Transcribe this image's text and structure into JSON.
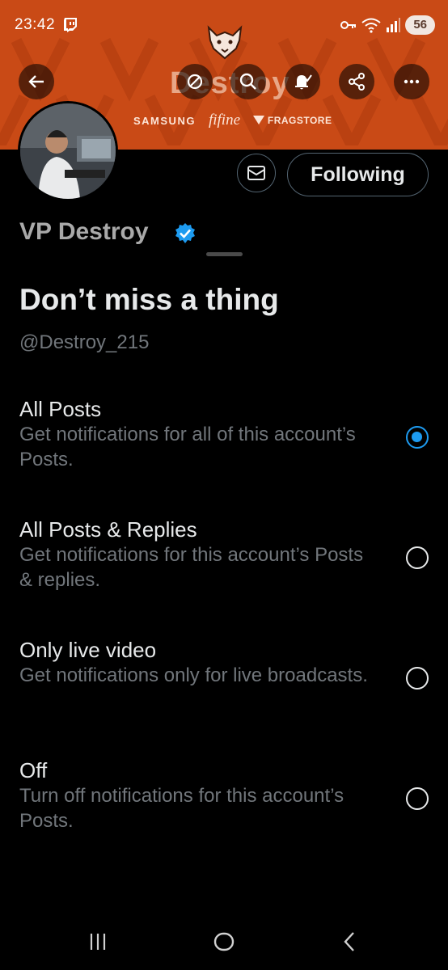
{
  "status_bar": {
    "time": "23:42",
    "battery": "56",
    "icons": [
      "twitch-icon",
      "key-icon",
      "wifi-icon",
      "signal-icon",
      "battery-icon"
    ]
  },
  "header": {
    "banner_name": "Destroy",
    "sponsors": [
      "SAMSUNG",
      "fifine",
      "FRAGSTORE"
    ],
    "icons": [
      "back-arrow-icon",
      "mute-icon",
      "search-icon",
      "bell-icon",
      "share-icon",
      "more-icon"
    ]
  },
  "profile": {
    "name": "VP Destroy",
    "following_label": "Following"
  },
  "sheet": {
    "title": "Don’t miss a thing",
    "handle": "@Destroy_215",
    "options": [
      {
        "title": "All Posts",
        "desc": "Get notifications for all of this account’s Posts.",
        "selected": true
      },
      {
        "title": "All Posts & Replies",
        "desc": "Get notifications for this account’s Posts & replies.",
        "selected": false
      },
      {
        "title": "Only live video",
        "desc": "Get notifications only for live broadcasts.",
        "selected": false
      },
      {
        "title": "Off",
        "desc": "Turn off notifications for this account’s Posts.",
        "selected": false
      }
    ]
  },
  "colors": {
    "banner": "#c94a16",
    "accent": "#1d9bf0",
    "background": "#000000",
    "muted_text": "#71767b"
  }
}
